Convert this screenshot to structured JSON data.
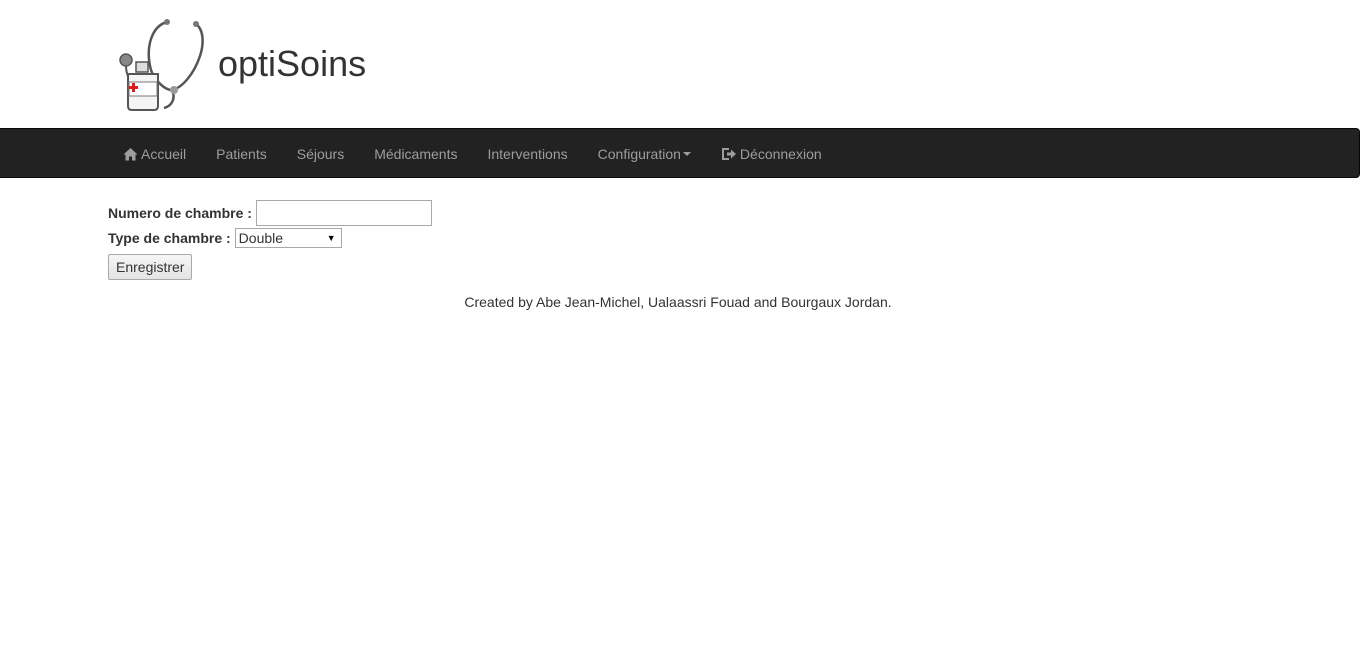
{
  "brand": {
    "title": "optiSoins",
    "logo_icon": "stethoscope-medicine-bottle-logo"
  },
  "colors": {
    "navbar_bg": "#222222",
    "nav_text": "#9d9d9d",
    "cross_red": "#e21a1a"
  },
  "nav": {
    "items": [
      {
        "label": "Accueil",
        "icon": "home-icon"
      },
      {
        "label": "Patients"
      },
      {
        "label": "Séjours"
      },
      {
        "label": "Médicaments"
      },
      {
        "label": "Interventions"
      },
      {
        "label": "Configuration",
        "icon": "caret-down-icon"
      },
      {
        "label": "Déconnexion",
        "icon": "logout-icon"
      }
    ]
  },
  "form": {
    "room_number_label": "Numero de chambre :",
    "room_number_value": "",
    "room_type_label": "Type de chambre :",
    "room_type_selected": "Double",
    "submit_label": "Enregistrer"
  },
  "footer": {
    "credits": "Created by Abe Jean-Michel, Ualaassri Fouad and Bourgaux Jordan."
  }
}
